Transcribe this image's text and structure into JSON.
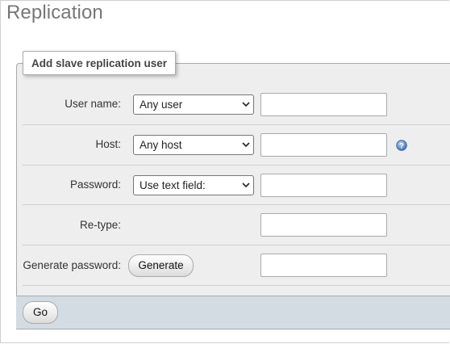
{
  "page": {
    "title": "Replication"
  },
  "form": {
    "legend": "Add slave replication user",
    "rows": [
      {
        "label": "User name:",
        "select_value": "Any user"
      },
      {
        "label": "Host:",
        "select_value": "Any host"
      },
      {
        "label": "Password:",
        "select_value": "Use text field:"
      },
      {
        "label": "Re-type:"
      },
      {
        "label": "Generate password:",
        "button_label": "Generate"
      }
    ],
    "inputs": {
      "user_name": "",
      "host": "",
      "password": "",
      "retype": "",
      "generated_password": ""
    }
  },
  "footer": {
    "go_label": "Go"
  },
  "icons": {
    "help": "help-icon",
    "dropdown": "chevron-down-icon"
  },
  "colors": {
    "fieldset_bg": "#eeeeee",
    "footer_bg": "#d3dce3",
    "title": "#777777",
    "help_icon": "#4a7fc1"
  }
}
